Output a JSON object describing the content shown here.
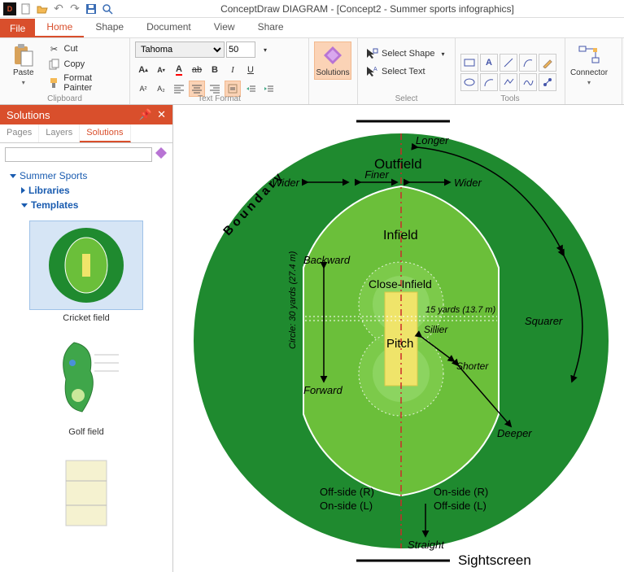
{
  "app": {
    "title": "ConceptDraw DIAGRAM - [Concept2 - Summer sports infographics]"
  },
  "tabs": {
    "file": "File",
    "home": "Home",
    "shape": "Shape",
    "document": "Document",
    "view": "View",
    "share": "Share"
  },
  "ribbon": {
    "paste": "Paste",
    "cut": "Cut",
    "copy": "Copy",
    "formatPainter": "Format Painter",
    "clipboard": "Clipboard",
    "font": "Tahoma",
    "fontSize": "50",
    "textFormat": "Text Format",
    "solutions": "Solutions",
    "selectShape": "Select Shape",
    "selectText": "Select Text",
    "selectGroup": "Select",
    "toolsGroup": "Tools",
    "connector": "Connector"
  },
  "sidepanel": {
    "title": "Solutions",
    "tabPages": "Pages",
    "tabLayers": "Layers",
    "tabSolutions": "Solutions",
    "nodeSummer": "Summer Sports",
    "nodeLibraries": "Libraries",
    "nodeTemplates": "Templates",
    "thumb1": "Cricket field",
    "thumb2": "Golf field"
  },
  "diagram": {
    "boundary": "Boundary",
    "outfield": "Outfield",
    "infield": "Infield",
    "closeInfield": "Close-Infield",
    "pitch": "Pitch",
    "longer": "Longer",
    "wider1": "Wider",
    "finer": "Finer",
    "wider2": "Wider",
    "backward": "Backward",
    "forward": "Forward",
    "squarer": "Squarer",
    "sillier": "Sillier",
    "shorter": "Shorter",
    "deeper": "Deeper",
    "straight": "Straight",
    "yards15": "15 yards (13.7 m)",
    "circle30": "Circle: 30 yards (27.4 m)",
    "offR": "Off-side (R)",
    "onL": "On-side (L)",
    "onR": "On-side (R)",
    "offL": "Off-side (L)",
    "sightscreen": "Sightscreen"
  }
}
